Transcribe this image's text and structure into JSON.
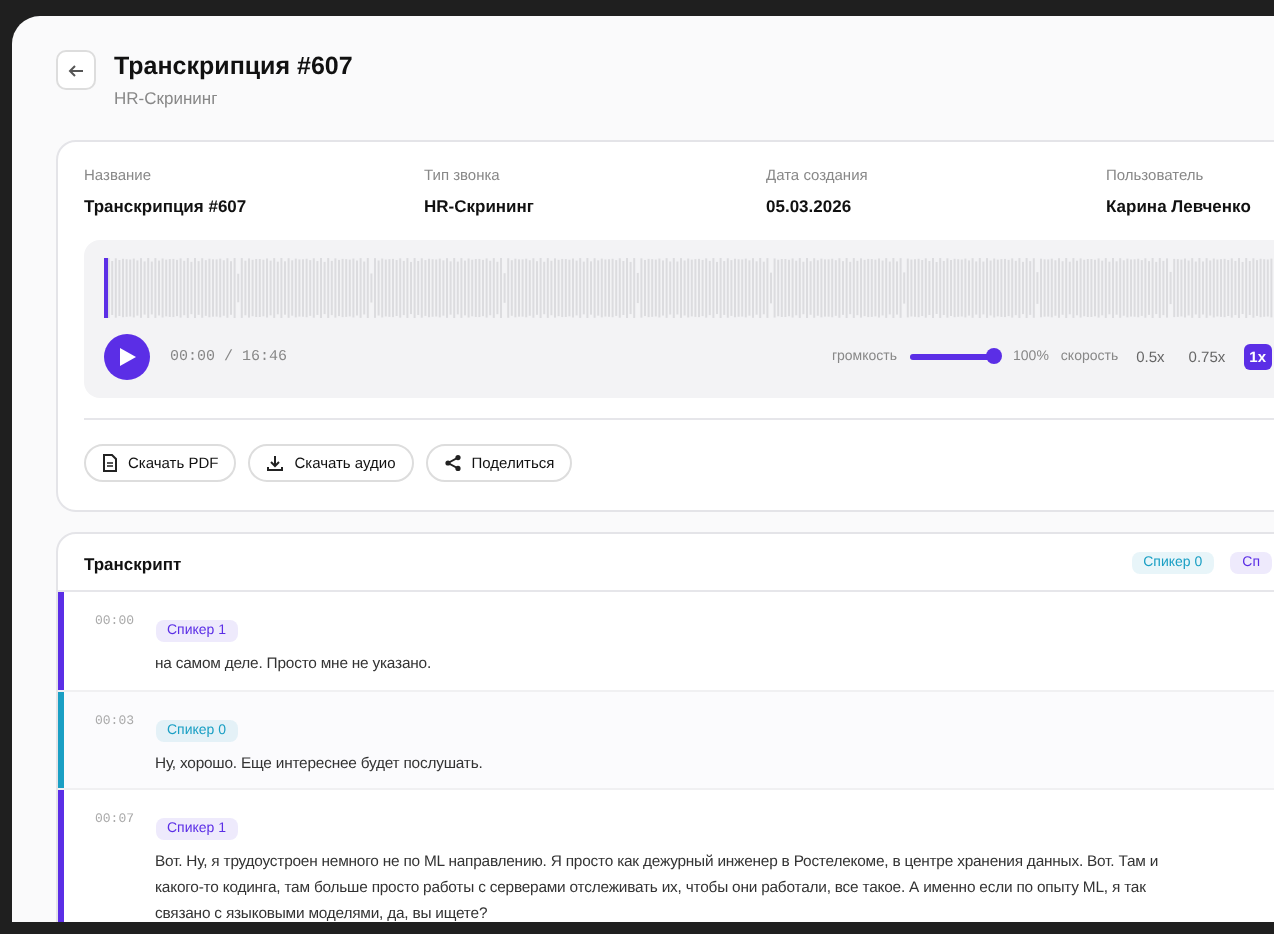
{
  "header": {
    "title": "Транскрипция #607",
    "subtitle": "HR-Скрининг"
  },
  "meta": [
    {
      "label": "Название",
      "value": "Транскрипция #607"
    },
    {
      "label": "Тип звонка",
      "value": "HR-Скрининг"
    },
    {
      "label": "Дата создания",
      "value": "05.03.2026"
    },
    {
      "label": "Пользователь",
      "value": "Карина Левченко"
    }
  ],
  "player": {
    "progress": {
      "level": 0
    },
    "time": "00:00 / 16:46",
    "volume_label": "громкость",
    "volume": {
      "level": 1
    },
    "volume_reading": "100%",
    "speed_label": "скорость",
    "speeds": [
      {
        "label": "0.5x",
        "selected": false
      },
      {
        "label": "0.75x",
        "selected": false
      },
      {
        "label": "1x",
        "selected": true
      }
    ]
  },
  "actions": [
    {
      "kind": "pdf",
      "label": "Скачать PDF"
    },
    {
      "kind": "download",
      "label": "Скачать аудио"
    },
    {
      "kind": "share",
      "label": "Поделиться"
    }
  ],
  "transcript": {
    "title": "Транскрипт",
    "speakers": [
      {
        "label": "Спикер 0",
        "color": "#1a9fc4"
      },
      {
        "label": "Сп",
        "color": "#5b2ee6"
      }
    ],
    "messages": [
      {
        "time": "00:00",
        "speaker": "Спикер 1",
        "color": "#5b2ee6",
        "lines": [
          "на самом деле. Просто мне не указано."
        ]
      },
      {
        "time": "00:03",
        "speaker": "Спикер 0",
        "color": "#1a9fc4",
        "lines": [
          "Ну, хорошо. Еще интереснее будет послушать."
        ]
      },
      {
        "time": "00:07",
        "speaker": "Спикер 1",
        "color": "#5b2ee6",
        "lines": [
          "Вот. Ну, я трудоустроен немного не по ML направлению. Я просто как дежурный инженер в Ростелекоме, в центре хранения данных. Вот. Там и",
          "какого-то кодинга, там больше просто работы с серверами отслеживать их, чтобы они работали, все такое. А именно если по опыту ML, я так",
          "связано с языковыми моделями, да, вы ищете?"
        ]
      }
    ]
  }
}
